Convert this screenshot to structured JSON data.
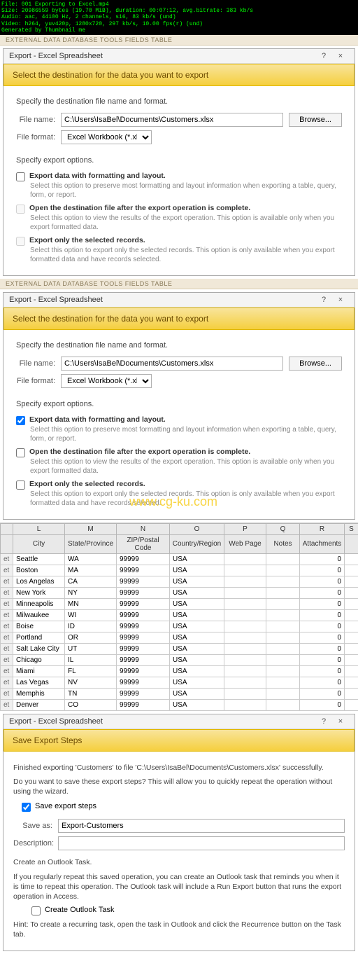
{
  "video_meta": {
    "l1": "File: 001 Exporting to Excel.mp4",
    "l2": "Size: 20986559 bytes (19.70 MiB), duration: 00:07:12, avg.bitrate: 383 kb/s",
    "l3": "Audio: aac, 44100 Hz, 2 channels, s16, 83 kb/s (und)",
    "l4": "Video: h264, yuv420p, 1280x720, 297 kb/s, 10.00 fps(r) (und)",
    "l5": "Generated by Thumbnail me"
  },
  "ribbon_tabs": "EXTERNAL DATA      DATABASE TOOLS      FIELDS      TABLE",
  "dialog_title": "Export - Excel Spreadsheet",
  "help_q": "?",
  "close_x": "×",
  "banner_text": "Select the destination for the data you want to export",
  "section1": "Specify the destination file name and format.",
  "file_name_label": "File name:",
  "file_name_value": "C:\\Users\\IsaBel\\Documents\\Customers.xlsx",
  "browse": "Browse...",
  "file_format_label": "File format:",
  "file_format_value": "Excel Workbook (*.xlsx)",
  "section2": "Specify export options.",
  "opt1_label": "Export data with formatting and layout.",
  "opt1_sub": "Select this option to preserve most formatting and layout information when exporting a table, query, form, or report.",
  "opt2_label": "Open the destination file after the export operation is complete.",
  "opt2_sub": "Select this option to view the results of the export operation. This option is available only when you export formatted data.",
  "opt3_label": "Export only the selected records.",
  "opt3_sub": "Select this option to export only the selected records. This option is only available when you export formatted data and have records selected.",
  "watermark": "www.cg-ku.com",
  "grid": {
    "col_letters": [
      "",
      "L",
      "M",
      "N",
      "O",
      "P",
      "Q",
      "R",
      "S"
    ],
    "col_headers": [
      "",
      "City",
      "State/Province",
      "ZIP/Postal Code",
      "Country/Region",
      "Web Page",
      "Notes",
      "Attachments",
      ""
    ],
    "rows": [
      [
        "et",
        "Seattle",
        "WA",
        "99999",
        "USA",
        "",
        "",
        "0",
        ""
      ],
      [
        "et",
        "Boston",
        "MA",
        "99999",
        "USA",
        "",
        "",
        "0",
        ""
      ],
      [
        "et",
        "Los Angelas",
        "CA",
        "99999",
        "USA",
        "",
        "",
        "0",
        ""
      ],
      [
        "et",
        "New York",
        "NY",
        "99999",
        "USA",
        "",
        "",
        "0",
        ""
      ],
      [
        "et",
        "Minneapolis",
        "MN",
        "99999",
        "USA",
        "",
        "",
        "0",
        ""
      ],
      [
        "et",
        "Milwaukee",
        "WI",
        "99999",
        "USA",
        "",
        "",
        "0",
        ""
      ],
      [
        "et",
        "Boise",
        "ID",
        "99999",
        "USA",
        "",
        "",
        "0",
        ""
      ],
      [
        "et",
        "Portland",
        "OR",
        "99999",
        "USA",
        "",
        "",
        "0",
        ""
      ],
      [
        "et",
        "Salt Lake City",
        "UT",
        "99999",
        "USA",
        "",
        "",
        "0",
        ""
      ],
      [
        "et",
        "Chicago",
        "IL",
        "99999",
        "USA",
        "",
        "",
        "0",
        ""
      ],
      [
        "et",
        "Miami",
        "FL",
        "99999",
        "USA",
        "",
        "",
        "0",
        ""
      ],
      [
        "et",
        "Las Vegas",
        "NV",
        "99999",
        "USA",
        "",
        "",
        "0",
        ""
      ],
      [
        "et",
        "Memphis",
        "TN",
        "99999",
        "USA",
        "",
        "",
        "0",
        ""
      ],
      [
        "et",
        "Denver",
        "CO",
        "99999",
        "USA",
        "",
        "",
        "0",
        ""
      ]
    ]
  },
  "save_steps": {
    "banner": "Save Export Steps",
    "finished": "Finished exporting 'Customers' to file 'C:\\Users\\IsaBel\\Documents\\Customers.xlsx' successfully.",
    "q": "Do you want to save these export steps? This will allow you to quickly repeat the operation without using the wizard.",
    "save_chk": "Save export steps",
    "save_as_label": "Save as:",
    "save_as_value": "Export-Customers",
    "desc_label": "Description:",
    "desc_value": "",
    "outlook_section": "Create an Outlook Task.",
    "outlook_text": "If you regularly repeat this saved operation, you can create an Outlook task that reminds you when it is time to repeat this operation. The Outlook task will include a Run Export button that runs the export operation in Access.",
    "outlook_chk": "Create Outlook Task",
    "hint": "Hint: To create a recurring task, open the task in Outlook and click the Recurrence button on the Task tab."
  }
}
